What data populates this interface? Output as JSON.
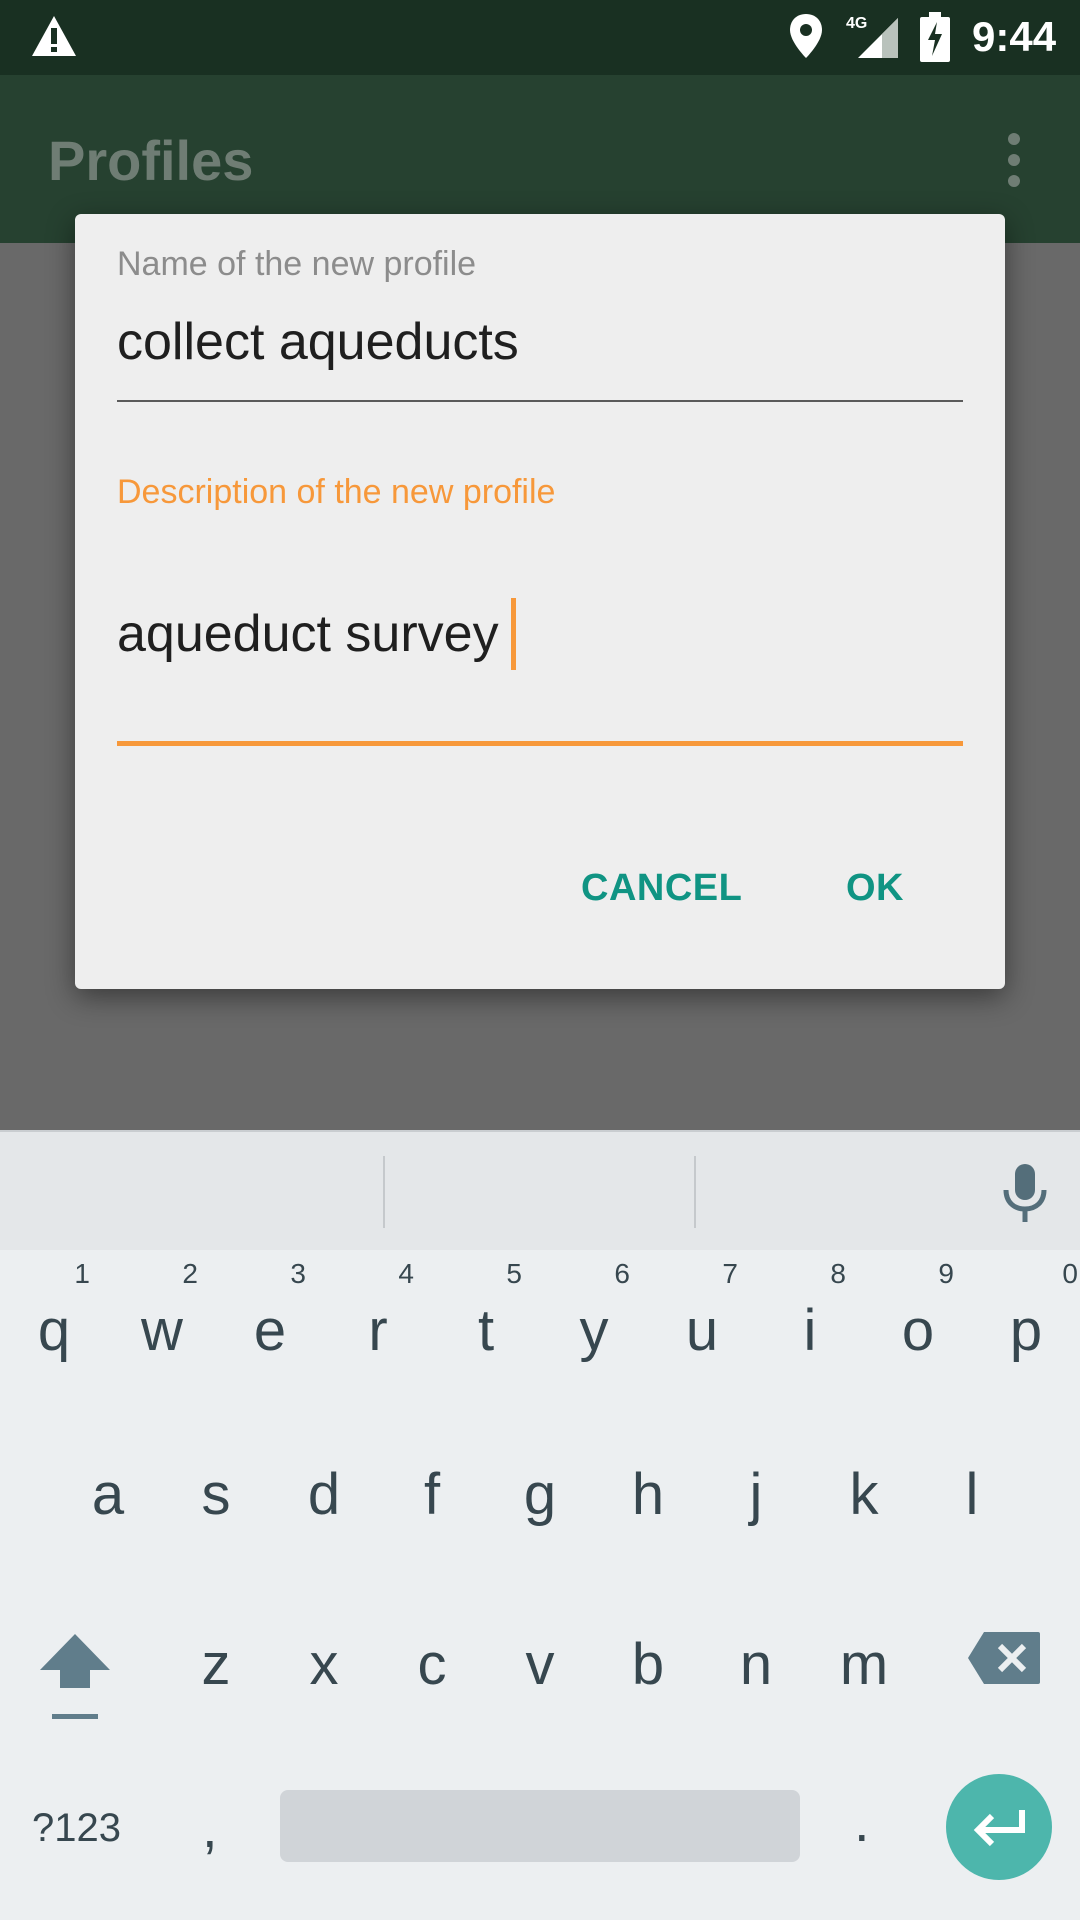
{
  "status_bar": {
    "time": "9:44",
    "network": "4G"
  },
  "app_bar": {
    "title": "Profiles"
  },
  "dialog": {
    "name_label": "Name of the new profile",
    "name_value": "collect aqueducts",
    "description_label": "Description of the new profile",
    "description_value": "aqueduct survey",
    "cancel_label": "CANCEL",
    "ok_label": "OK"
  },
  "keyboard": {
    "row1": [
      {
        "key": "q",
        "hint": "1"
      },
      {
        "key": "w",
        "hint": "2"
      },
      {
        "key": "e",
        "hint": "3"
      },
      {
        "key": "r",
        "hint": "4"
      },
      {
        "key": "t",
        "hint": "5"
      },
      {
        "key": "y",
        "hint": "6"
      },
      {
        "key": "u",
        "hint": "7"
      },
      {
        "key": "i",
        "hint": "8"
      },
      {
        "key": "o",
        "hint": "9"
      },
      {
        "key": "p",
        "hint": "0"
      }
    ],
    "row2": [
      "a",
      "s",
      "d",
      "f",
      "g",
      "h",
      "j",
      "k",
      "l"
    ],
    "row3": [
      "z",
      "x",
      "c",
      "v",
      "b",
      "n",
      "m"
    ],
    "symbols_label": "?123",
    "comma": ",",
    "period": "."
  },
  "colors": {
    "accent": "#f7983a",
    "button_text": "#109483",
    "enter_key": "#4db6ac",
    "status_bar": "#193022"
  }
}
